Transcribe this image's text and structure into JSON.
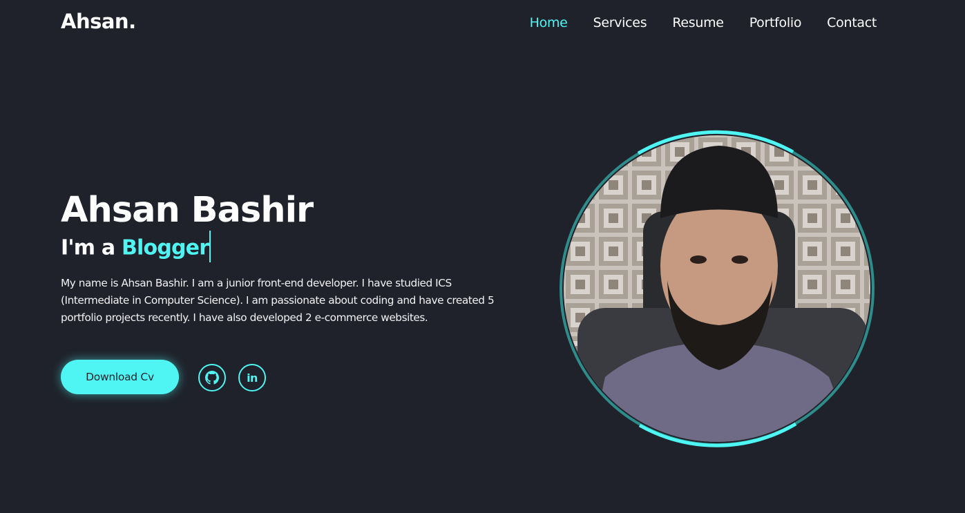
{
  "header": {
    "logo": "Ahsan.",
    "nav": [
      {
        "label": "Home",
        "active": true
      },
      {
        "label": "Services",
        "active": false
      },
      {
        "label": "Resume",
        "active": false
      },
      {
        "label": "Portfolio",
        "active": false
      },
      {
        "label": "Contact",
        "active": false
      }
    ]
  },
  "hero": {
    "name": "Ahsan Bashir",
    "role_prefix": "I'm a",
    "role_word": "Blogger",
    "bio": "My name is Ahsan Bashir. I am a junior front-end developer. I have studied ICS (Intermediate in Computer Science). I am passionate about coding and have created 5 portfolio projects recently. I have also developed 2 e-commerce websites.",
    "cta_label": "Download Cv",
    "social": [
      {
        "name": "github",
        "icon": "github-icon"
      },
      {
        "name": "linkedin",
        "icon": "linkedin-icon",
        "text": "in"
      }
    ]
  },
  "colors": {
    "background": "#1f222b",
    "accent": "#4ff5f2",
    "text": "#ffffff"
  }
}
